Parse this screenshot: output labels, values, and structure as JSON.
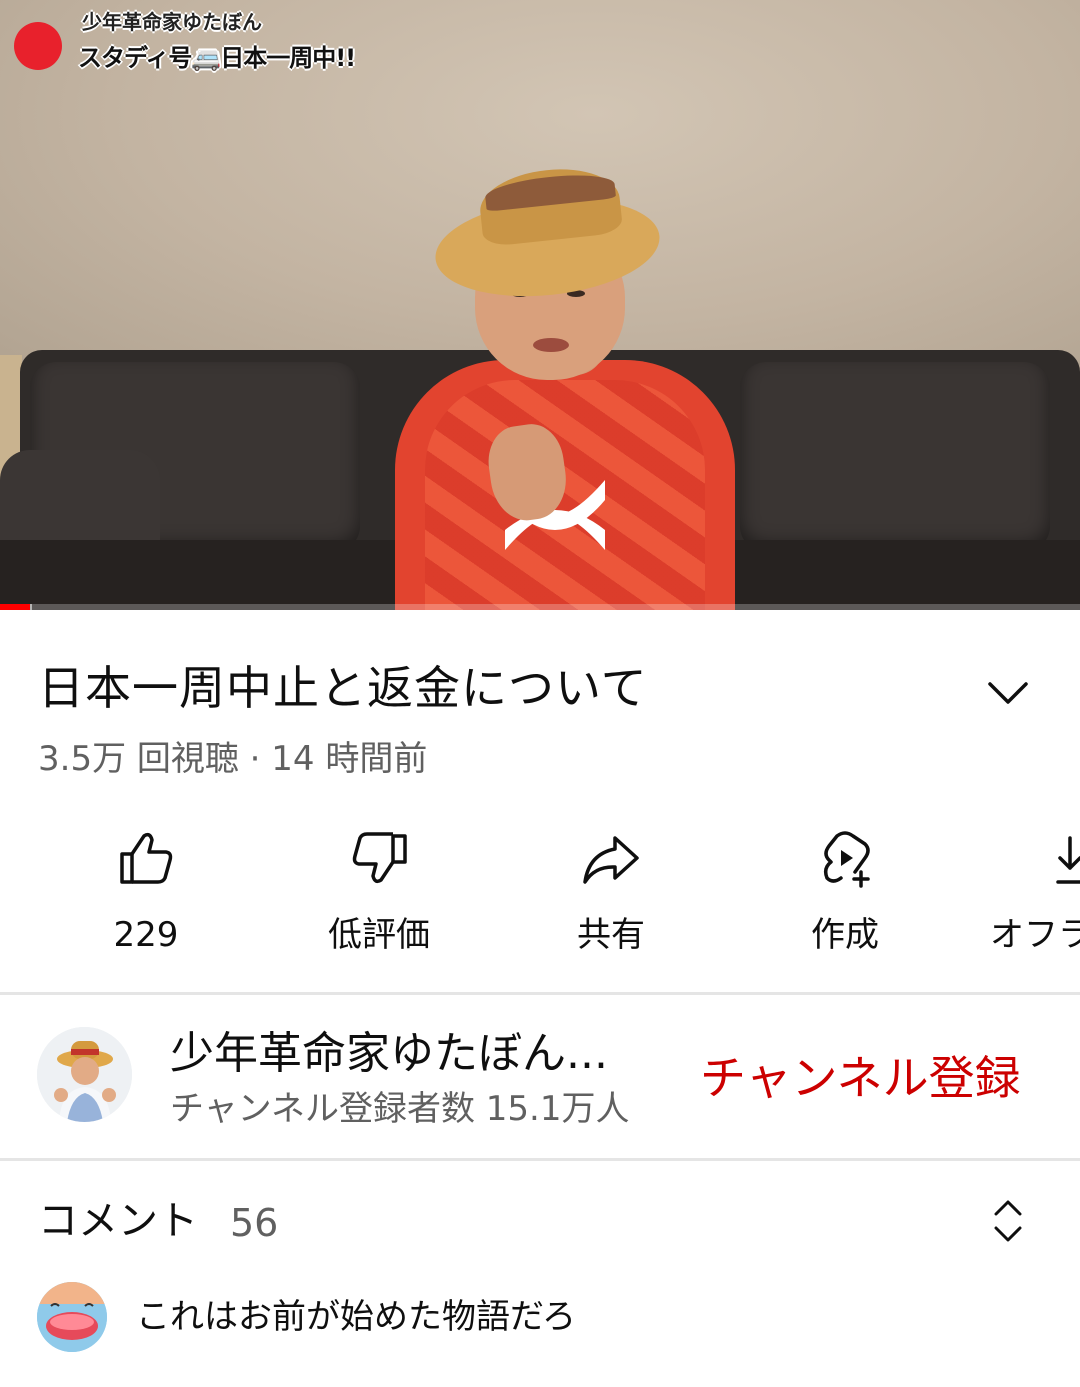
{
  "video": {
    "overlay_line1": "少年革命家ゆたぼん",
    "overlay_line2": "スタディ号🚐日本一周中!!",
    "progress_fraction": 0.028,
    "buffer_fraction": 0.03
  },
  "title": "日本一周中止と返金について",
  "meta": "3.5万 回視聴 · 14 時間前",
  "actions": [
    {
      "label": "229",
      "icon": "thumbs-up-icon"
    },
    {
      "label": "低評価",
      "icon": "thumbs-down-icon"
    },
    {
      "label": "共有",
      "icon": "share-icon"
    },
    {
      "label": "作成",
      "icon": "create-icon"
    },
    {
      "label": "オフラ",
      "icon": "download-icon"
    }
  ],
  "channel": {
    "name": "少年革命家ゆたぼん...",
    "subscribers": "チャンネル登録者数 15.1万人",
    "subscribe_label": "チャンネル登録"
  },
  "comments": {
    "heading": "コメント",
    "count": "56",
    "top_comment": "これはお前が始めた物語だろ"
  },
  "colors": {
    "subscribe": "#cc0000",
    "progress": "#ff0000",
    "secondary_text": "#606060"
  }
}
